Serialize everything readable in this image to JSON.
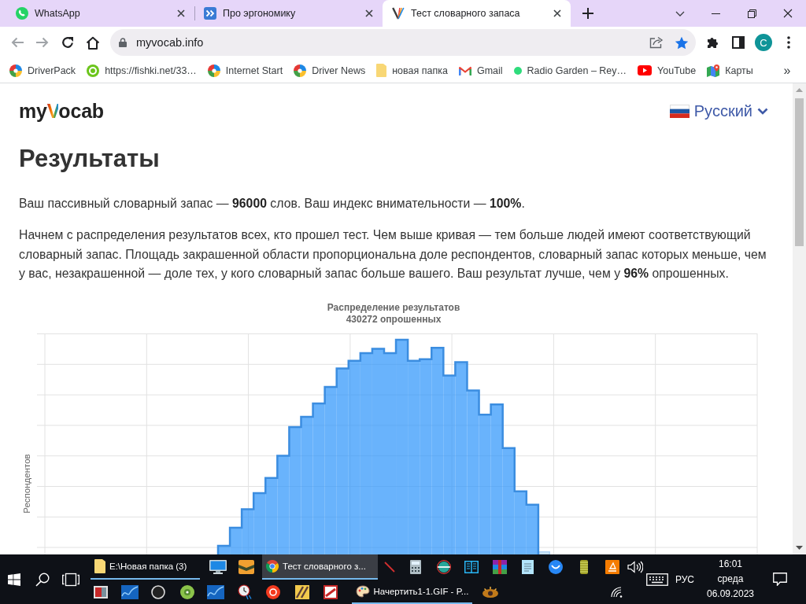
{
  "browser": {
    "tabs": [
      {
        "title": "WhatsApp",
        "selected": false
      },
      {
        "title": "Про эргономику",
        "selected": false
      },
      {
        "title": "Тест словарного запаса",
        "selected": true
      }
    ],
    "back_disabled": true,
    "forward_disabled": true,
    "address": "myvocab.info",
    "bookmarked": true,
    "profile": "C",
    "bookmarks": [
      {
        "label": "DriverPack"
      },
      {
        "label": "https://fishki.net/33…"
      },
      {
        "label": "Internet Start"
      },
      {
        "label": "Driver News"
      },
      {
        "label": "новая папка"
      },
      {
        "label": "Gmail"
      },
      {
        "label": "Radio Garden – Rey…"
      },
      {
        "label": "YouTube"
      },
      {
        "label": "Карты"
      }
    ],
    "bookmarks_overflow": "»"
  },
  "page": {
    "logo": "myVocab",
    "language": "Русский",
    "heading": "Результаты",
    "paragraphs": [
      "Ваш пассивный словарный запас — **96000** слов. Ваш индекс внимательности — **100%**.",
      "Начнем с распределения результатов всех, кто прошел тест. Чем выше кривая — тем больше людей имеют соответствующий словарный запас. Площадь закрашенной области пропорциональна доле респондентов, словарный запас которых меньше, чем у вас, незакрашенной — доле тех, у кого словарный запас больше вашего. Ваш результат лучше, чем у **96%** опрошенных."
    ],
    "chart": {
      "title": "Распределение результатов",
      "subtitle": "430272 опрошенных",
      "ylabel": "Респондентов"
    }
  },
  "taskbar": {
    "windows": [
      {
        "label": "E:\\Новая папка (3)",
        "selected": false
      },
      {
        "label": "Тест словарного з...",
        "selected": true
      },
      {
        "label": "Начертить1-1.GIF - P...",
        "selected": false
      }
    ],
    "tray": {
      "language": "РУС",
      "time": "16:01",
      "day": "среда",
      "date": "06.09.2023"
    }
  }
}
